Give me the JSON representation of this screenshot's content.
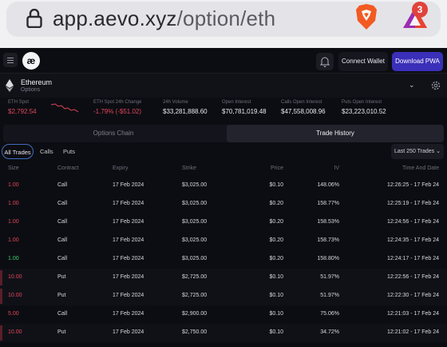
{
  "browser": {
    "url_domain": "app.aevo.xyz",
    "url_path": "/option/eth",
    "notification_count": "3"
  },
  "header": {
    "logo_text": "æ",
    "connect_wallet": "Connect Wallet",
    "download_pwa": "Download PWA"
  },
  "asset": {
    "name": "Ethereum",
    "subtitle": "Options"
  },
  "stats": [
    {
      "label": "ETH Spot",
      "value": "$2,792.54",
      "tone": "red"
    },
    {
      "label": "ETH Spot 24h Change",
      "value": "-1.79% (-$51.02)",
      "tone": "red"
    },
    {
      "label": "24h Volume",
      "value": "$33,281,888.60",
      "tone": "normal"
    },
    {
      "label": "Open Interest",
      "value": "$70,781,019.48",
      "tone": "normal"
    },
    {
      "label": "Calls Open Interest",
      "value": "$47,558,008.96",
      "tone": "normal"
    },
    {
      "label": "Puts Open Interest",
      "value": "$23,223,010.52",
      "tone": "normal"
    }
  ],
  "tabs": [
    "Options Chain",
    "Trade History"
  ],
  "filters": {
    "all": "All Trades",
    "calls": "Calls",
    "puts": "Puts",
    "range": "Last 250 Trades ⌄"
  },
  "columns": [
    "Size",
    "Contract",
    "Expiry",
    "Strike",
    "Price",
    "IV",
    "Time And Date"
  ],
  "trades": [
    {
      "size": "1.00",
      "contract": "Call",
      "expiry": "17 Feb 2024",
      "strike": "$3,025.00",
      "price": "$0.10",
      "iv": "148.06%",
      "time": "12:26:25 - 17 Feb 24",
      "side": "red"
    },
    {
      "size": "1.00",
      "contract": "Call",
      "expiry": "17 Feb 2024",
      "strike": "$3,025.00",
      "price": "$0.20",
      "iv": "158.77%",
      "time": "12:25:19 - 17 Feb 24",
      "side": "red"
    },
    {
      "size": "1.00",
      "contract": "Call",
      "expiry": "17 Feb 2024",
      "strike": "$3,025.00",
      "price": "$0.20",
      "iv": "158.53%",
      "time": "12:24:56 - 17 Feb 24",
      "side": "red"
    },
    {
      "size": "1.00",
      "contract": "Call",
      "expiry": "17 Feb 2024",
      "strike": "$3,025.00",
      "price": "$0.20",
      "iv": "158.73%",
      "time": "12:24:35 - 17 Feb 24",
      "side": "red"
    },
    {
      "size": "1.00",
      "contract": "Call",
      "expiry": "17 Feb 2024",
      "strike": "$3,025.00",
      "price": "$0.20",
      "iv": "158.80%",
      "time": "12:24:17 - 17 Feb 24",
      "side": "green"
    },
    {
      "size": "10.00",
      "contract": "Put",
      "expiry": "17 Feb 2024",
      "strike": "$2,725.00",
      "price": "$0.10",
      "iv": "51.97%",
      "time": "12:22:56 - 17 Feb 24",
      "side": "red"
    },
    {
      "size": "10.00",
      "contract": "Put",
      "expiry": "17 Feb 2024",
      "strike": "$2,725.00",
      "price": "$0.10",
      "iv": "51.97%",
      "time": "12:22:30 - 17 Feb 24",
      "side": "red"
    },
    {
      "size": "5.00",
      "contract": "Call",
      "expiry": "17 Feb 2024",
      "strike": "$2,900.00",
      "price": "$0.10",
      "iv": "75.06%",
      "time": "12:21:03 - 17 Feb 24",
      "side": "red"
    },
    {
      "size": "10.00",
      "contract": "Put",
      "expiry": "17 Feb 2024",
      "strike": "$2,750.00",
      "price": "$0.10",
      "iv": "34.72%",
      "time": "12:21:02 - 17 Feb 24",
      "side": "red"
    }
  ],
  "colors": {
    "accent": "#3a2fb8",
    "sell": "#e0475a",
    "buy": "#3fce6f"
  }
}
